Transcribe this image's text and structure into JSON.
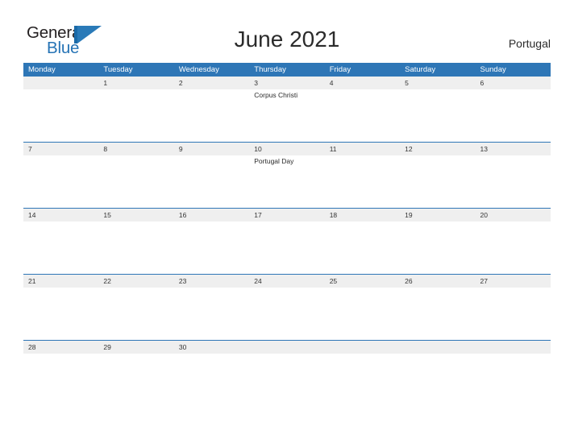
{
  "brand": {
    "name_part1": "General",
    "name_part2": "Blue",
    "logo_icon": "triangle-flag-logo",
    "color_dark": "#231f20",
    "color_blue": "#2573b5"
  },
  "header": {
    "title": "June 2021",
    "country": "Portugal"
  },
  "colors": {
    "header_blue": "#2e76b6",
    "row_band": "#efefef",
    "row_divider": "#2e76b6",
    "text": "#333333",
    "page_background": "#ffffff"
  },
  "calendar": {
    "month": "June",
    "year": "2021",
    "weekday_headers": [
      "Monday",
      "Tuesday",
      "Wednesday",
      "Thursday",
      "Friday",
      "Saturday",
      "Sunday"
    ],
    "weeks": [
      [
        {
          "date": "",
          "events": []
        },
        {
          "date": "1",
          "events": []
        },
        {
          "date": "2",
          "events": []
        },
        {
          "date": "3",
          "events": [
            "Corpus Christi"
          ]
        },
        {
          "date": "4",
          "events": []
        },
        {
          "date": "5",
          "events": []
        },
        {
          "date": "6",
          "events": []
        }
      ],
      [
        {
          "date": "7",
          "events": []
        },
        {
          "date": "8",
          "events": []
        },
        {
          "date": "9",
          "events": []
        },
        {
          "date": "10",
          "events": [
            "Portugal Day"
          ]
        },
        {
          "date": "11",
          "events": []
        },
        {
          "date": "12",
          "events": []
        },
        {
          "date": "13",
          "events": []
        }
      ],
      [
        {
          "date": "14",
          "events": []
        },
        {
          "date": "15",
          "events": []
        },
        {
          "date": "16",
          "events": []
        },
        {
          "date": "17",
          "events": []
        },
        {
          "date": "18",
          "events": []
        },
        {
          "date": "19",
          "events": []
        },
        {
          "date": "20",
          "events": []
        }
      ],
      [
        {
          "date": "21",
          "events": []
        },
        {
          "date": "22",
          "events": []
        },
        {
          "date": "23",
          "events": []
        },
        {
          "date": "24",
          "events": []
        },
        {
          "date": "25",
          "events": []
        },
        {
          "date": "26",
          "events": []
        },
        {
          "date": "27",
          "events": []
        }
      ],
      [
        {
          "date": "28",
          "events": []
        },
        {
          "date": "29",
          "events": []
        },
        {
          "date": "30",
          "events": []
        },
        {
          "date": "",
          "events": []
        },
        {
          "date": "",
          "events": []
        },
        {
          "date": "",
          "events": []
        },
        {
          "date": "",
          "events": []
        }
      ]
    ]
  }
}
